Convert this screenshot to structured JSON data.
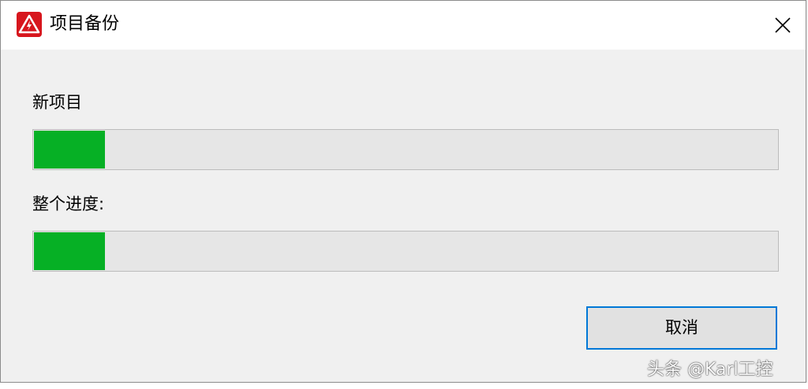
{
  "window": {
    "title": "项目备份",
    "icon": "warning-triangle-icon",
    "close_icon": "close-icon"
  },
  "current_item": {
    "label": "新项目",
    "progress": 0.095
  },
  "overall": {
    "label": "整个进度:",
    "progress": 0.095
  },
  "buttons": {
    "cancel_label": "取消"
  },
  "colors": {
    "progress_fill": "#06b025",
    "accent": "#0078d7",
    "app_icon_bg": "#d7161d"
  },
  "watermark": "头条 @Karl工控"
}
